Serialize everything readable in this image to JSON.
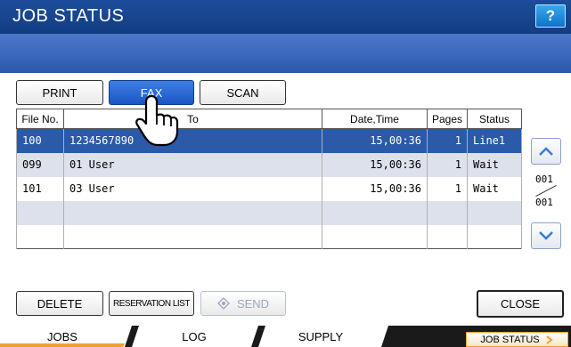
{
  "header": {
    "title": "JOB STATUS",
    "help_label": "?"
  },
  "job_tabs": [
    {
      "label": "PRINT",
      "active": false
    },
    {
      "label": "FAX",
      "active": true
    },
    {
      "label": "SCAN",
      "active": false
    }
  ],
  "table": {
    "columns": [
      "File No.",
      "To",
      "Date,Time",
      "Pages",
      "Status"
    ],
    "rows": [
      {
        "file_no": "100",
        "to": "1234567890",
        "datetime": "15,00:36",
        "pages": "1",
        "status": "Line1",
        "selected": true
      },
      {
        "file_no": "099",
        "to": "01 User",
        "datetime": "15,00:36",
        "pages": "1",
        "status": "Wait",
        "selected": false
      },
      {
        "file_no": "101",
        "to": "03 User",
        "datetime": "15,00:36",
        "pages": "1",
        "status": "Wait",
        "selected": false
      },
      {
        "file_no": "",
        "to": "",
        "datetime": "",
        "pages": "",
        "status": "",
        "selected": false
      },
      {
        "file_no": "",
        "to": "",
        "datetime": "",
        "pages": "",
        "status": "",
        "selected": false
      }
    ]
  },
  "pager": {
    "current": "001",
    "total": "001",
    "up_icon": "chevron-up-icon",
    "down_icon": "chevron-down-icon"
  },
  "actions": {
    "delete_label": "DELETE",
    "reservation_label": "RESERVATION LIST",
    "send_label": "SEND",
    "close_label": "CLOSE"
  },
  "bottom_tabs": [
    {
      "label": "JOBS",
      "active": true
    },
    {
      "label": "LOG",
      "active": false
    },
    {
      "label": "SUPPLY",
      "active": false
    }
  ],
  "status_button": {
    "label": "JOB STATUS",
    "icon": "chevron-right-icon"
  },
  "colors": {
    "title_bar": "#1d4d9a",
    "band": "#3a66bb",
    "selected_row": "#2b5aa8",
    "active_tab": "#f0a030"
  }
}
